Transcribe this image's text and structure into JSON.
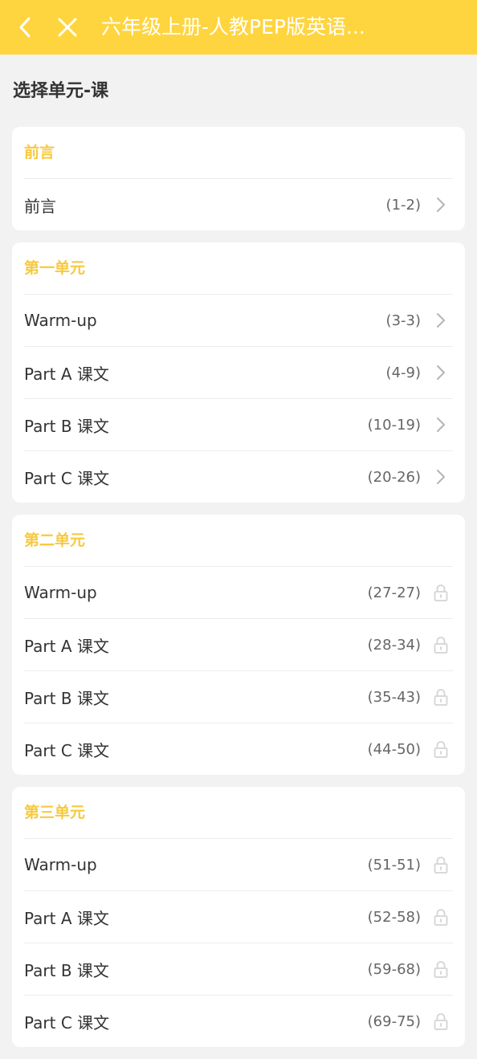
{
  "header": {
    "title": "六年级上册-人教PEP版英语...",
    "back_icon": "chevron-left-icon",
    "close_icon": "close-icon",
    "background_color": "#ffd53f"
  },
  "page": {
    "section_heading": "选择单元-课"
  },
  "colors": {
    "accent": "#f7c93e",
    "card_bg": "#ffffff",
    "page_bg": "#f2f2f2"
  },
  "units": [
    {
      "title": "前言",
      "lessons": [
        {
          "label": "前言",
          "pages": "(1-2)",
          "locked": false
        }
      ]
    },
    {
      "title": "第一单元",
      "lessons": [
        {
          "label": "Warm-up",
          "pages": "(3-3)",
          "locked": false
        },
        {
          "label": "Part A 课文",
          "pages": "(4-9)",
          "locked": false
        },
        {
          "label": "Part B 课文",
          "pages": "(10-19)",
          "locked": false
        },
        {
          "label": "Part C 课文",
          "pages": "(20-26)",
          "locked": false
        }
      ]
    },
    {
      "title": "第二单元",
      "lessons": [
        {
          "label": "Warm-up",
          "pages": "(27-27)",
          "locked": true
        },
        {
          "label": "Part A 课文",
          "pages": "(28-34)",
          "locked": true
        },
        {
          "label": "Part B 课文",
          "pages": "(35-43)",
          "locked": true
        },
        {
          "label": "Part C 课文",
          "pages": "(44-50)",
          "locked": true
        }
      ]
    },
    {
      "title": "第三单元",
      "lessons": [
        {
          "label": "Warm-up",
          "pages": "(51-51)",
          "locked": true
        },
        {
          "label": "Part A 课文",
          "pages": "(52-58)",
          "locked": true
        },
        {
          "label": "Part B 课文",
          "pages": "(59-68)",
          "locked": true
        },
        {
          "label": "Part C 课文",
          "pages": "(69-75)",
          "locked": true
        }
      ]
    }
  ]
}
